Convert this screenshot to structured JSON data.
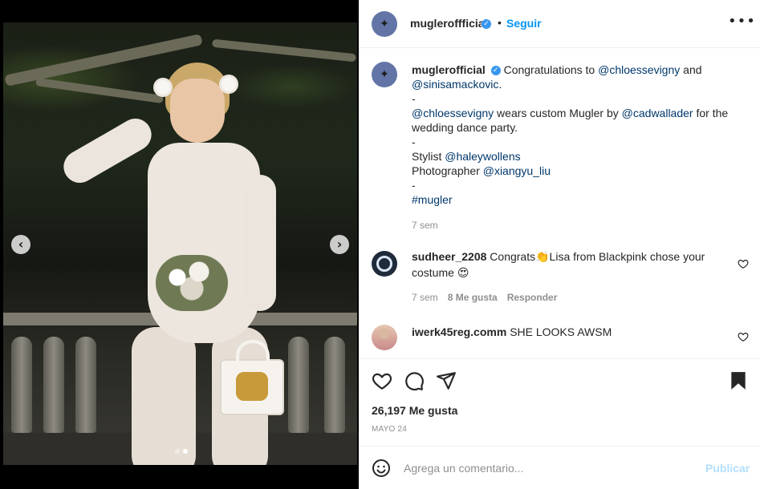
{
  "post": {
    "author": "mugleroffficial",
    "author_display": "mugleroffficial",
    "follow_label": "Seguir",
    "separator": "•",
    "more_label": "•••",
    "avatar_glyph": "✦",
    "verified_glyph": "✓"
  },
  "media": {
    "prev_label": "‹",
    "next_label": "›",
    "slide_count": 2,
    "active_slide": 2
  },
  "caption": {
    "username": "muglerofficial",
    "lines": [
      {
        "parts": [
          {
            "text": "Congratulations to "
          },
          {
            "text": "@chloessevigny",
            "mention": true
          },
          {
            "text": " and"
          }
        ]
      },
      {
        "parts": [
          {
            "text": "@sinisamackovic",
            "mention": true
          },
          {
            "text": "."
          }
        ]
      },
      {
        "parts": [
          {
            "text": "-"
          }
        ]
      },
      {
        "parts": [
          {
            "text": "@chloessevigny",
            "mention": true
          },
          {
            "text": " wears custom Mugler by "
          },
          {
            "text": "@cadwallader",
            "mention": true
          },
          {
            "text": " for the"
          }
        ]
      },
      {
        "parts": [
          {
            "text": "wedding dance party."
          }
        ]
      },
      {
        "parts": [
          {
            "text": "-"
          }
        ]
      },
      {
        "parts": [
          {
            "text": "Stylist "
          },
          {
            "text": "@haleywollens",
            "mention": true
          }
        ]
      },
      {
        "parts": [
          {
            "text": "Photographer "
          },
          {
            "text": "@xiangyu_liu",
            "mention": true
          }
        ]
      },
      {
        "parts": [
          {
            "text": "-"
          }
        ]
      },
      {
        "parts": [
          {
            "text": "#mugler",
            "mention": true
          }
        ]
      }
    ],
    "time": "7 sem"
  },
  "comments": [
    {
      "username": "sudheer_2208",
      "text": "Congrats",
      "emoji1": "👏",
      "text2": "Lisa from Blackpink chose your",
      "text3": "costume",
      "emoji2": "😍",
      "time": "7 sem",
      "likes": "8 Me gusta",
      "reply_label": "Responder"
    },
    {
      "username": "iwerk45reg.comm",
      "text": "SHE LOOKS AWSM"
    }
  ],
  "actions": {
    "likes_text": "26,197 Me gusta",
    "date": "MAYO 24"
  },
  "composer": {
    "placeholder": "Agrega un comentario...",
    "publish_label": "Publicar"
  },
  "colors": {
    "link": "#0095f6",
    "mention": "#00376b",
    "muted": "#8e8e8e",
    "publish_disabled": "#b2dffc",
    "verified": "#3897f0"
  }
}
